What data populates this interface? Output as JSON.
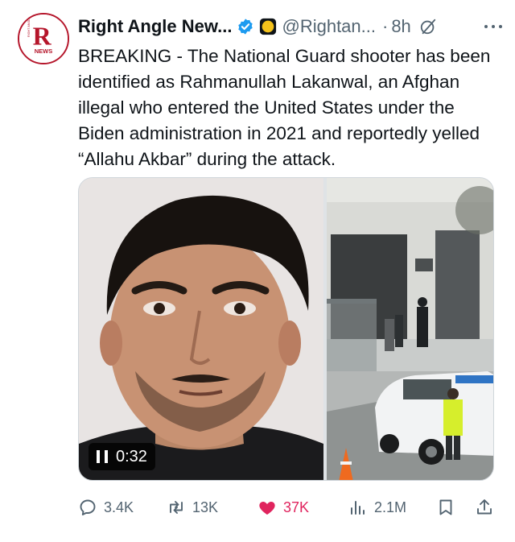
{
  "post": {
    "author_name": "Right Angle New...",
    "author_handle": "@Rightan...",
    "separator": "·",
    "time_ago": "8h",
    "text": "BREAKING - The National Guard shooter has been identified as Rahmanullah Lakanwal, an Afghan illegal who entered the United States under the Biden administration in 2021 and reportedly yelled “Allahu Akbar” during the attack.",
    "avatar_logo_letter": "R",
    "avatar_logo_lines": [
      "RIGHT ANGLE",
      "NEWS"
    ]
  },
  "media": {
    "video_duration": "0:32",
    "left_image": "portrait-of-man",
    "right_image": "street-scene-police-vehicle"
  },
  "actions": {
    "replies": "3.4K",
    "reposts": "13K",
    "likes": "37K",
    "views": "2.1M"
  },
  "colors": {
    "like": "#e0245e",
    "verified_blue": "#1d9bf0",
    "gold_badge": "#f4c21b",
    "secondary_text": "#536471",
    "brand_red": "#b5162b"
  },
  "icons": {
    "reply": "reply-icon",
    "repost": "repost-icon",
    "like": "heart-filled-icon",
    "views": "views-icon",
    "bookmark": "bookmark-icon",
    "share": "share-icon",
    "more": "more-icon",
    "grok": "grok-icon",
    "pause": "pause-icon"
  }
}
